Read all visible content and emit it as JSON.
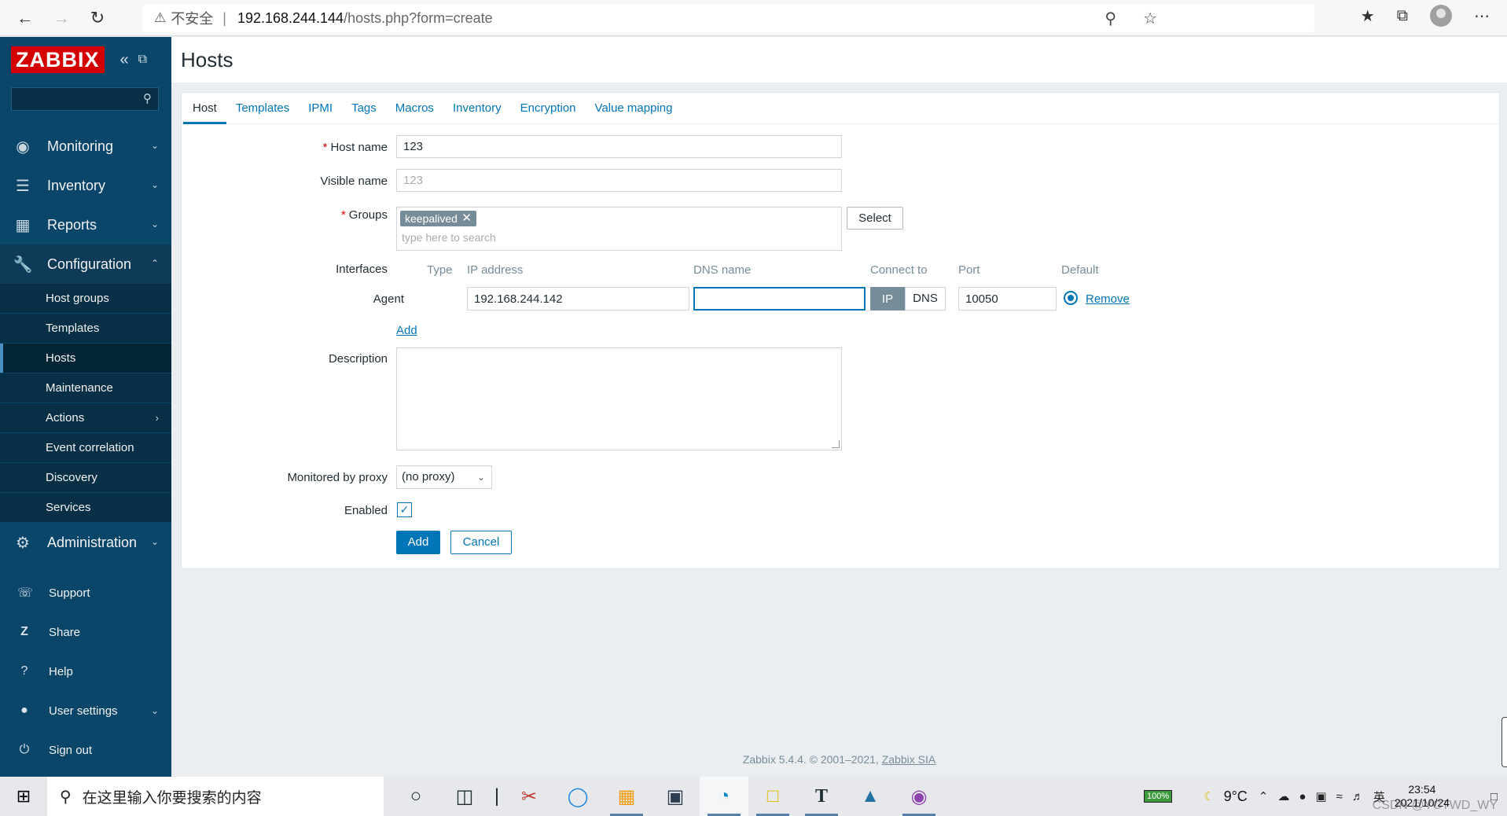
{
  "browser": {
    "security_label": "不安全",
    "url_host": "192.168.244.144",
    "url_path": "/hosts.php?form=create"
  },
  "sidebar": {
    "logo": "ZABBIX",
    "menu": [
      {
        "label": "Monitoring",
        "icon": "eye-icon"
      },
      {
        "label": "Inventory",
        "icon": "list-icon"
      },
      {
        "label": "Reports",
        "icon": "bar-chart-icon"
      },
      {
        "label": "Configuration",
        "icon": "wrench-icon"
      }
    ],
    "config_sub": [
      "Host groups",
      "Templates",
      "Hosts",
      "Maintenance",
      "Actions",
      "Event correlation",
      "Discovery",
      "Services"
    ],
    "admin_label": "Administration",
    "bottom": [
      "Support",
      "Share",
      "Help",
      "User settings",
      "Sign out"
    ]
  },
  "page": {
    "title": "Hosts",
    "tabs": [
      "Host",
      "Templates",
      "IPMI",
      "Tags",
      "Macros",
      "Inventory",
      "Encryption",
      "Value mapping"
    ]
  },
  "form": {
    "host_name_label": "Host name",
    "host_name_value": "123",
    "visible_name_label": "Visible name",
    "visible_name_placeholder": "123",
    "groups_label": "Groups",
    "group_tag": "keepalived",
    "groups_placeholder": "type here to search",
    "select_button": "Select",
    "interfaces_label": "Interfaces",
    "if_headers": {
      "type": "Type",
      "ip": "IP address",
      "dns": "DNS name",
      "connect": "Connect to",
      "port": "Port",
      "default": "Default"
    },
    "agent_label": "Agent",
    "ip_value": "192.168.244.142",
    "dns_value": "",
    "connect_ip": "IP",
    "connect_dns": "DNS",
    "port_value": "10050",
    "remove_link": "Remove",
    "add_link": "Add",
    "description_label": "Description",
    "proxy_label": "Monitored by proxy",
    "proxy_value": "(no proxy)",
    "enabled_label": "Enabled",
    "add_button": "Add",
    "cancel_button": "Cancel"
  },
  "footer": {
    "text": "Zabbix 5.4.4. © 2001–2021,",
    "link": "Zabbix SIA"
  },
  "taskbar": {
    "search_placeholder": "在这里输入你要搜索的内容",
    "battery": "100%",
    "weather": "9°C",
    "time": "23:54",
    "date": "2021/10/24",
    "ime": "英",
    "watermark": "CSDN @YCTWD_WY"
  }
}
